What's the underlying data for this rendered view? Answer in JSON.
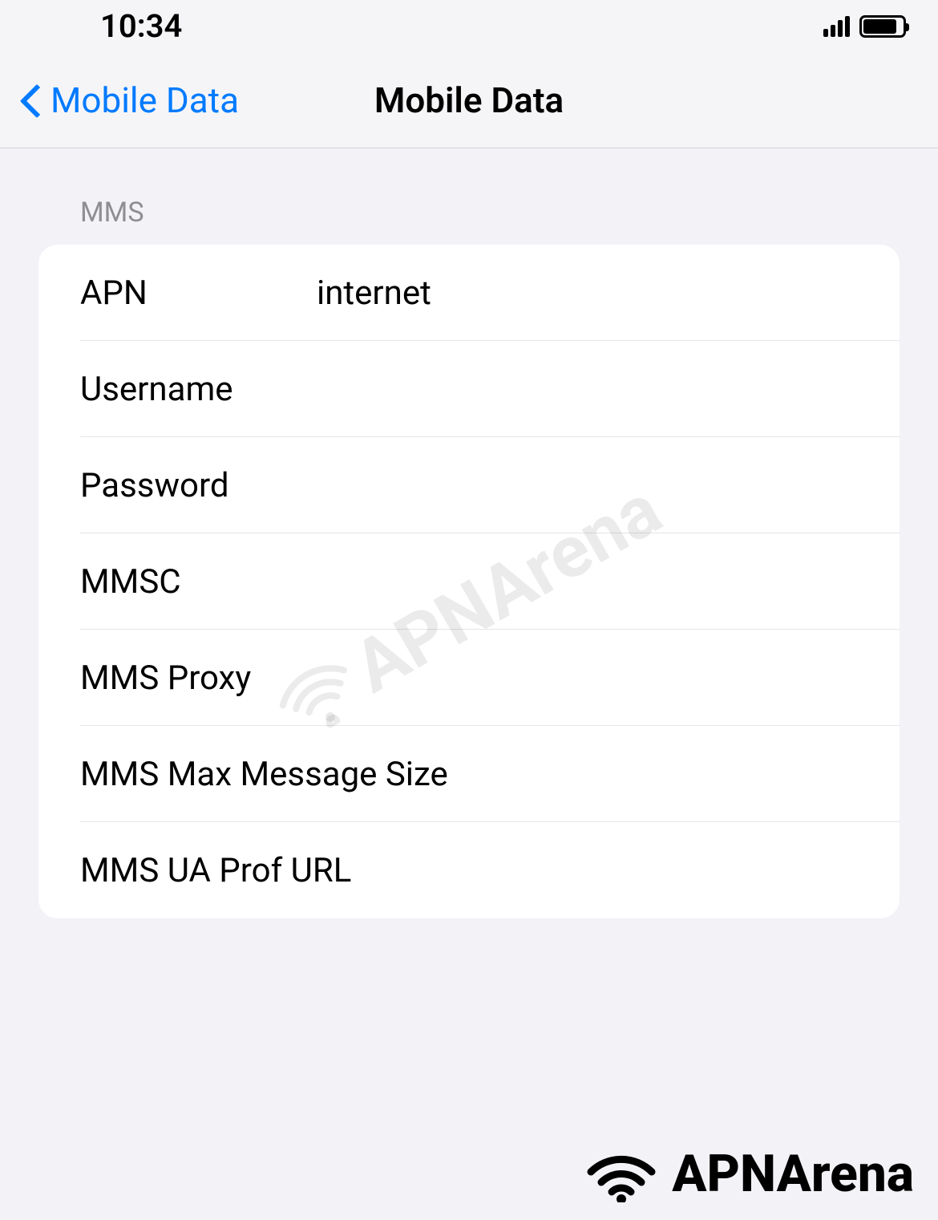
{
  "status_bar": {
    "time": "10:34"
  },
  "nav": {
    "back_label": "Mobile Data",
    "title": "Mobile Data"
  },
  "section": {
    "header": "MMS",
    "rows": [
      {
        "label": "APN",
        "value": "internet"
      },
      {
        "label": "Username",
        "value": ""
      },
      {
        "label": "Password",
        "value": ""
      },
      {
        "label": "MMSC",
        "value": ""
      },
      {
        "label": "MMS Proxy",
        "value": ""
      },
      {
        "label": "MMS Max Message Size",
        "value": ""
      },
      {
        "label": "MMS UA Prof URL",
        "value": ""
      }
    ]
  },
  "watermark": "APNArena",
  "footer_brand": "APNArena"
}
